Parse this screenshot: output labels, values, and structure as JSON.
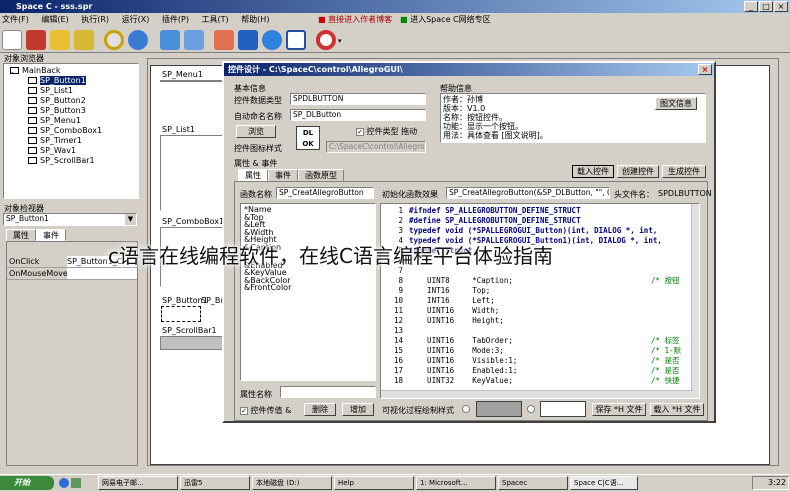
{
  "main_window": {
    "title": "Space C - sss.spr",
    "menu": [
      "文件(F)",
      "编辑(E)",
      "执行(R)",
      "运行(X)",
      "插件(P)",
      "工具(T)",
      "帮助(H)"
    ],
    "links": [
      "直接进入作者博客",
      "进入Space C网络专区"
    ]
  },
  "object_viewer": {
    "title": "对象浏览器",
    "tree": [
      "MainBack",
      "SP_Button1",
      "SP_List1",
      "SP_Button2",
      "SP_Button3",
      "SP_Menu1",
      "SP_ComboBox1",
      "SP_Timer1",
      "SP_Wav1",
      "SP_ScrollBar1"
    ]
  },
  "object_inspector": {
    "title": "对象检视器",
    "selected": "SP_Button1",
    "tabs": [
      "属性",
      "事件"
    ],
    "rows": [
      {
        "name": "OnClick",
        "value": "SP_Button1_Cl"
      },
      {
        "name": "OnMouseMove",
        "value": ""
      }
    ]
  },
  "design": {
    "labels": [
      "SP_Menu1",
      "SP_List1",
      "SP_ComboBox1",
      "SP_Button1",
      "SP_But",
      "SP_ScrollBar1"
    ]
  },
  "dialog": {
    "title": "控件设计 - C:\\SpaceC\\control\\AllegroGUI\\",
    "basic_info": "基本信息",
    "type_label": "控件数据类型",
    "type_value": "SPDLBUTTON",
    "auto_name_label": "自动命名名称",
    "auto_name_value": "SP_DLButton",
    "browse": "浏览",
    "icon_style_label": "控件图标样式",
    "icon_text": "DL OK",
    "type_check": "控件类型 拖动",
    "path": "C:\\SpaceC\\control\\AllegroGUI\\",
    "help_title": "帮助信息",
    "help_lines": [
      "作者：孙博",
      "版本：V1.0",
      "名称：按钮控件。",
      "功能：显示一个按钮。",
      "用法：具体查看 [图文说明]。"
    ],
    "help_button": "图文信息",
    "attr_event": "属性 & 事件",
    "tabs": [
      "属性",
      "事件",
      "函数原型"
    ],
    "buttons_top": [
      "载入控件",
      "创建控件",
      "生成控件"
    ],
    "func_name_label": "函数名称",
    "func_name_value": "SP_CreatAllegroButton",
    "init_label": "初始化函数效果",
    "init_value": "SP_CreatAllegroButton(&SP_DLButton, \"\", 0, 0, 0,",
    "header_label": "头文件名：",
    "header_value": "SPDLBUTTON",
    "props": [
      "*Name",
      "&Top",
      "&Left",
      "&Width",
      "&Height",
      "&Caption",
      "&Enabled",
      "&KeyValue",
      "&BackColor",
      "&FrontColor"
    ],
    "prop_name_label": "属性名称",
    "prop_check": "控件传值 &",
    "delete": "删除",
    "add": "增加",
    "visual_label": "可视化过程绘制样式",
    "save_h": "保存 *H 文件",
    "load_h": "载入 *H 文件",
    "code": [
      {
        "n": "1",
        "t": "#ifndef SP_ALLEGROBUTTON_DEFINE_STRUCT",
        "c": ""
      },
      {
        "n": "2",
        "t": "#define SP_ALLEGROBUTTON_DEFINE_STRUCT",
        "c": ""
      },
      {
        "n": "3",
        "t": "typedef void (*SPALLEGROGUI_Button)(int, DIALOG *, int,",
        "c": ""
      },
      {
        "n": "4",
        "t": "typedef void (*SPALLEGROGUI_Button1)(int, DIALOG *, int,",
        "c": ""
      },
      {
        "n": "5",
        "t": "typedef struct",
        "c": ""
      },
      {
        "n": "6",
        "t": "{",
        "c": ""
      },
      {
        "n": "7",
        "t": "",
        "c": ""
      },
      {
        "n": "8",
        "t": "    UINT8     *Caption;",
        "c": "/* 按钮"
      },
      {
        "n": "9",
        "t": "    INT16     Top;",
        "c": ""
      },
      {
        "n": "10",
        "t": "    INT16     Left;",
        "c": ""
      },
      {
        "n": "11",
        "t": "    UINT16    Width;",
        "c": ""
      },
      {
        "n": "12",
        "t": "    UINT16    Height;",
        "c": ""
      },
      {
        "n": "13",
        "t": "",
        "c": ""
      },
      {
        "n": "14",
        "t": "    UINT16    TabOrder;",
        "c": "/* 标签"
      },
      {
        "n": "15",
        "t": "    UINT16    Mode:3;",
        "c": "/* 1-默"
      },
      {
        "n": "16",
        "t": "    UINT16    Visible:1;",
        "c": "/* 是否"
      },
      {
        "n": "17",
        "t": "    UINT16    Enabled:1;",
        "c": "/* 是否"
      },
      {
        "n": "18",
        "t": "    UINT32    KeyValue;",
        "c": "/* 快捷"
      }
    ]
  },
  "overlay_text": "c语言在线编程软件，在线C语言编程平台体验指南",
  "taskbar": {
    "start": "开始",
    "tasks": [
      "网易电子邮...",
      "迅雷5",
      "本地磁盘 (D:)",
      "Help",
      "1: Microsoft...",
      "Spacec",
      "Space C|C语..."
    ],
    "clock": "3:22"
  }
}
